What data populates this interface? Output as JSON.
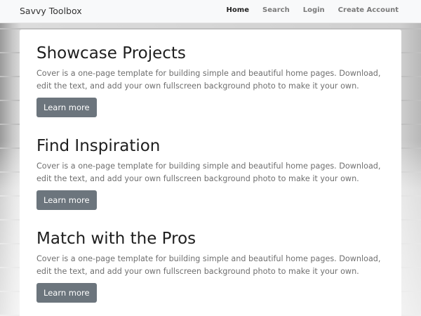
{
  "navbar": {
    "brand": "Savvy Toolbox",
    "links": [
      "Home",
      "Search",
      "Login",
      "Create Account"
    ]
  },
  "sections": [
    {
      "title": "Showcase Projects",
      "text": "Cover is a one-page template for building simple and beautiful home pages. Download, edit the text, and add your own fullscreen background photo to make it your own.",
      "button": "Learn more"
    },
    {
      "title": "Find Inspiration",
      "text": "Cover is a one-page template for building simple and beautiful home pages. Download, edit the text, and add your own fullscreen background photo to make it your own.",
      "button": "Learn more"
    },
    {
      "title": "Match with the Pros",
      "text": "Cover is a one-page template for building simple and beautiful home pages. Download, edit the text, and add your own fullscreen background photo to make it your own.",
      "button": "Learn more"
    }
  ],
  "colors": {
    "button_bg": "#6c757d",
    "navbar_bg": "#f8f9fa",
    "active_link": "#222222",
    "muted_link": "#7a7a7a"
  }
}
